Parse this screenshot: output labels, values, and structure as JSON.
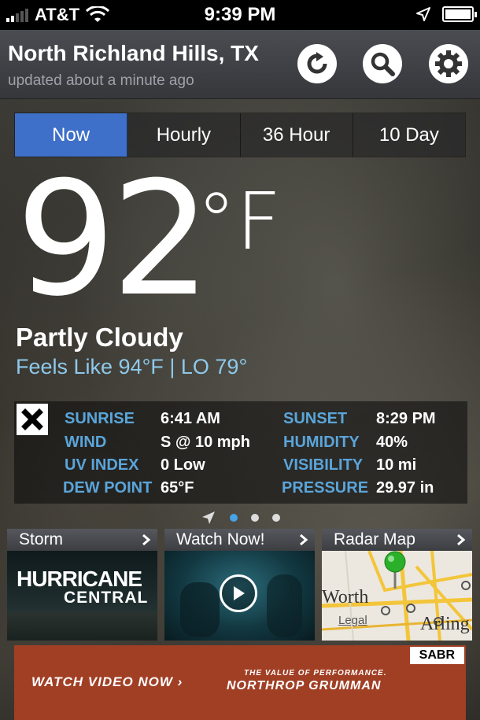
{
  "status_bar": {
    "carrier": "AT&T",
    "time": "9:39 PM"
  },
  "header": {
    "location": "North Richland Hills, TX",
    "updated": "updated about a minute ago"
  },
  "tabs": [
    {
      "label": "Now",
      "active": true
    },
    {
      "label": "Hourly",
      "active": false
    },
    {
      "label": "36 Hour",
      "active": false
    },
    {
      "label": "10 Day",
      "active": false
    }
  ],
  "current": {
    "temperature": "92",
    "unit": "°F",
    "condition": "Partly Cloudy",
    "feels_like": "Feels Like 94°F |  LO 79°"
  },
  "details": [
    {
      "label": "SUNRISE",
      "value": "6:41 AM"
    },
    {
      "label": "SUNSET",
      "value": "8:29 PM"
    },
    {
      "label": "WIND",
      "value": "S @ 10 mph"
    },
    {
      "label": "HUMIDITY",
      "value": "40%"
    },
    {
      "label": "UV INDEX",
      "value": "0 Low"
    },
    {
      "label": "VISIBILITY",
      "value": "10 mi"
    },
    {
      "label": "DEW POINT",
      "value": "65°F"
    },
    {
      "label": "PRESSURE",
      "value": "29.97 in"
    }
  ],
  "pager": {
    "pages": 3,
    "current": 1
  },
  "cards": [
    {
      "title": "Storm",
      "image_text_1": "HURRICANE",
      "image_text_2": "CENTRAL"
    },
    {
      "title": "Watch Now!"
    },
    {
      "title": "Radar Map",
      "map_label_1": "Worth",
      "map_label_2": "Arling",
      "map_legal": "Legal"
    }
  ],
  "ad": {
    "cta": "WATCH VIDEO NOW ›",
    "sponsor_tag": "SABR",
    "tagline": "THE VALUE OF PERFORMANCE.",
    "brand": "NORTHROP GRUMMAN"
  },
  "colors": {
    "accent": "#3e6fc9",
    "label_blue": "#5aa5da",
    "feels_blue": "#8ec9ea",
    "ad_bg": "#a13f25"
  }
}
